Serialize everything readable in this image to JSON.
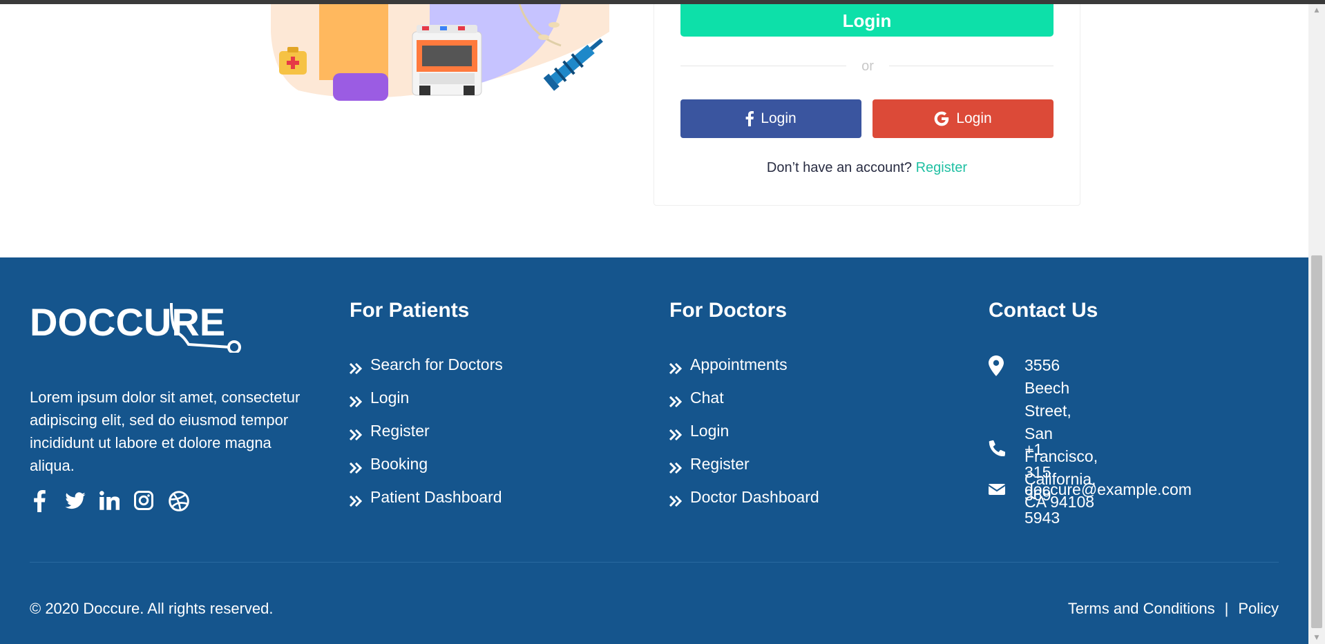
{
  "login": {
    "primary_label": "Login",
    "or_text": "or",
    "facebook_label": "Login",
    "google_label": "Login",
    "no_account_text": "Don’t have an account?",
    "register_link": "Register"
  },
  "footer": {
    "logo_text": "DOCCURE",
    "about": "Lorem ipsum dolor sit amet, consectetur adipiscing elit, sed do eiusmod tempor incididunt ut labore et dolore magna aliqua.",
    "social_icons": [
      "facebook-icon",
      "twitter-icon",
      "linkedin-icon",
      "instagram-icon",
      "dribbble-icon"
    ],
    "patients": {
      "title": "For Patients",
      "links": [
        "Search for Doctors",
        "Login",
        "Register",
        "Booking",
        "Patient Dashboard"
      ]
    },
    "doctors": {
      "title": "For Doctors",
      "links": [
        "Appointments",
        "Chat",
        "Login",
        "Register",
        "Doctor Dashboard"
      ]
    },
    "contact": {
      "title": "Contact Us",
      "address_line1": "3556 Beech Street, San",
      "address_line2": "Francisco,",
      "address_line3": "California, CA 94108",
      "phone": "+1 315 369 5943",
      "email": "doccure@example.com"
    },
    "copyright": "© 2020 Doccure. All rights reserved.",
    "terms": "Terms and Conditions",
    "separator": "|",
    "policy": "Policy"
  },
  "colors": {
    "accent": "#0de0a9",
    "footer_bg": "#15558d",
    "facebook": "#3a559f",
    "google": "#dc4a38",
    "register_link": "#20c0a3"
  }
}
